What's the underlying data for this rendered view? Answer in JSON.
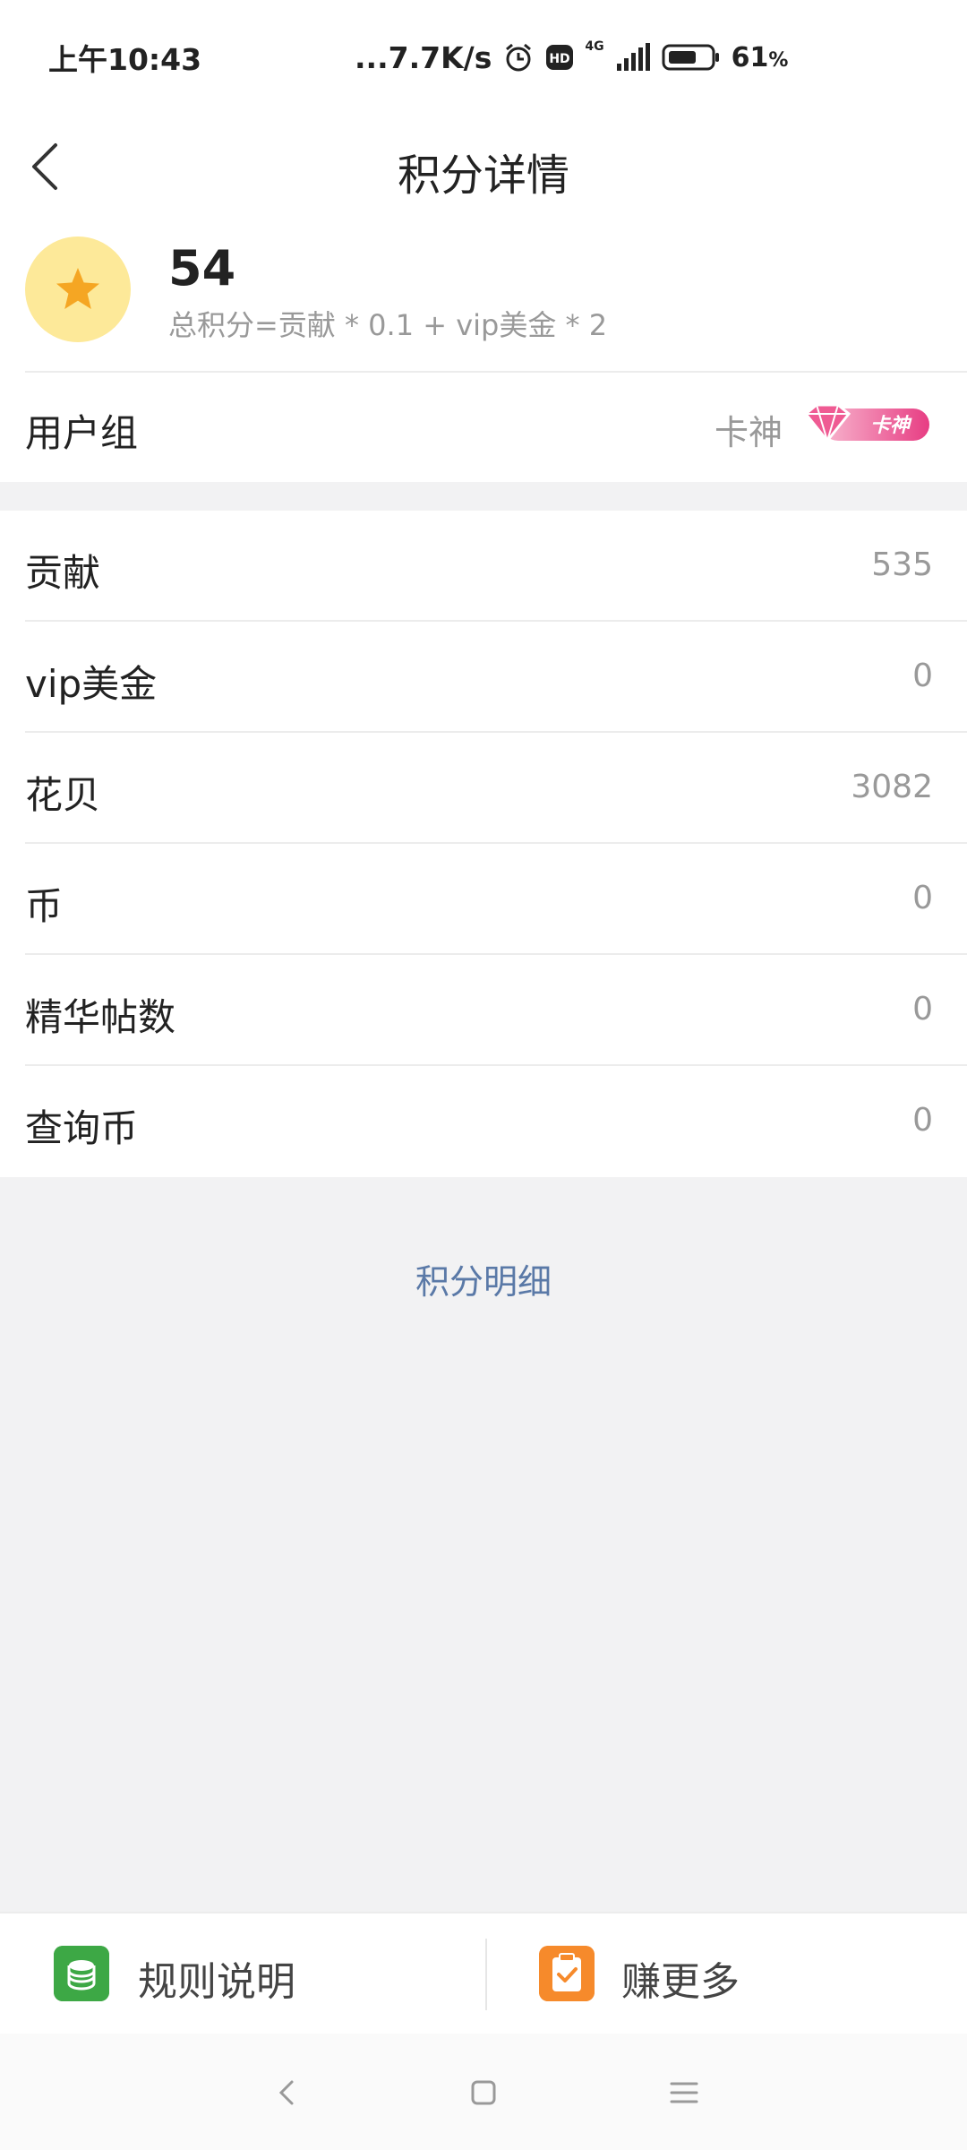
{
  "status_bar": {
    "time": "上午10:43",
    "network_speed": "...7.7K/s",
    "network_type": "4G",
    "battery_percent": "61",
    "battery_unit": "%",
    "icons": [
      "alarm-icon",
      "hd-icon",
      "signal-icon",
      "battery-icon"
    ]
  },
  "header": {
    "title": "积分详情",
    "back_icon": "back-arrow-icon"
  },
  "score": {
    "value": "54",
    "formula": "总积分=贡献 * 0.1 + vip美金 * 2",
    "icon": "star-icon",
    "badge_color": "#fde999"
  },
  "user_group": {
    "label": "用户组",
    "value": "卡神",
    "badge_icon": "diamond-badge-icon",
    "badge_text": "卡神"
  },
  "stats": [
    {
      "label": "贡献",
      "value": "535"
    },
    {
      "label": "vip美金",
      "value": "0"
    },
    {
      "label": "花贝",
      "value": "3082"
    },
    {
      "label": "币",
      "value": "0"
    },
    {
      "label": "精华帖数",
      "value": "0"
    },
    {
      "label": "查询币",
      "value": "0"
    }
  ],
  "detail_link": "积分明细",
  "bottom_bar": {
    "rules_label": "规则说明",
    "rules_icon": "coin-stack-icon",
    "earn_label": "赚更多",
    "earn_icon": "clipboard-check-icon"
  },
  "system_nav": {
    "back": "nav-back-icon",
    "home": "nav-home-icon",
    "menu": "nav-menu-icon"
  },
  "colors": {
    "link": "#5a79a7",
    "muted": "#999999",
    "accent_green": "#3da845",
    "accent_orange": "#f68a2b",
    "badge_pink": "#e73d83"
  }
}
